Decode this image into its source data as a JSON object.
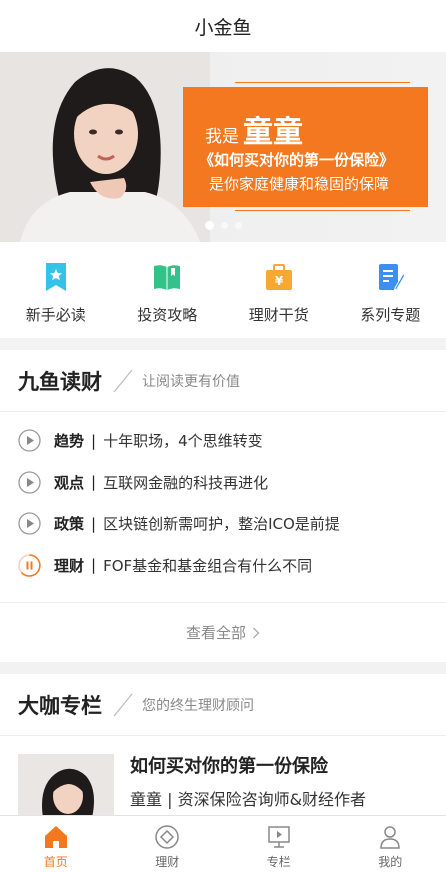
{
  "header": {
    "title": "小金鱼"
  },
  "banner": {
    "line1_prefix": "我是",
    "line1_name": "童童",
    "line2": "《如何买对你的第一份保险》",
    "line3": "是你家庭健康和稳固的保障",
    "slide_count": 3,
    "active_slide": 1
  },
  "quick_nav": [
    {
      "label": "新手必读",
      "icon": "bookmark-icon",
      "color": "#35c2e8"
    },
    {
      "label": "投资攻略",
      "icon": "open-book-icon",
      "color": "#34c18a"
    },
    {
      "label": "理财干货",
      "icon": "yen-briefcase-icon",
      "color": "#f7a833"
    },
    {
      "label": "系列专题",
      "icon": "document-pen-icon",
      "color": "#3a8ff0"
    }
  ],
  "reading": {
    "title": "九鱼读财",
    "subtitle": "让阅读更有价值",
    "items": [
      {
        "tag": "趋势",
        "text": "十年职场，4个思维转变",
        "state": "play"
      },
      {
        "tag": "观点",
        "text": "互联网金融的科技再进化",
        "state": "play"
      },
      {
        "tag": "政策",
        "text": "区块链创新需呵护，整治ICO是前提",
        "state": "play"
      },
      {
        "tag": "理财",
        "text": "FOF基金和基金组合有什么不同",
        "state": "pause"
      }
    ],
    "more_label": "查看全部"
  },
  "columns": {
    "title": "大咖专栏",
    "subtitle": "您的终生理财顾问",
    "item": {
      "title": "如何买对你的第一份保险",
      "author": "童童 | 资深保险咨询师&财经作者"
    }
  },
  "tabbar": [
    {
      "label": "首页",
      "icon": "home-icon",
      "active": true
    },
    {
      "label": "理财",
      "icon": "finance-circle-icon",
      "active": false
    },
    {
      "label": "专栏",
      "icon": "column-play-icon",
      "active": false
    },
    {
      "label": "我的",
      "icon": "user-icon",
      "active": false
    }
  ],
  "colors": {
    "accent": "#f3781f",
    "inactive": "#888888"
  }
}
